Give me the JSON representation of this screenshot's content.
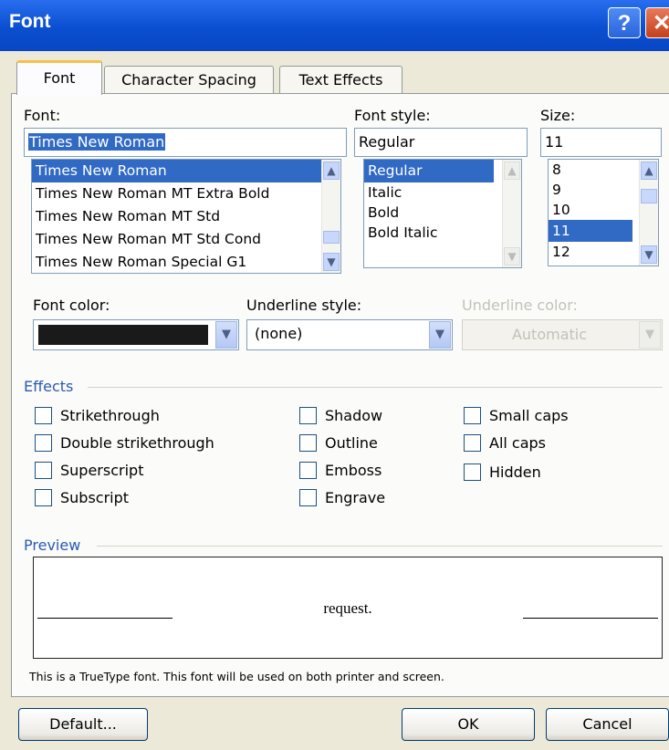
{
  "window": {
    "title": "Font",
    "help_glyph": "?",
    "close_glyph": "✕"
  },
  "tabs": [
    {
      "label": "Font",
      "active": true
    },
    {
      "label": "Character Spacing",
      "active": false
    },
    {
      "label": "Text Effects",
      "active": false
    }
  ],
  "font": {
    "label": "Font:",
    "value": "Times New Roman",
    "items": [
      "Times New Roman",
      "Times New Roman MT Extra Bold",
      "Times New Roman MT Std",
      "Times New Roman MT Std Cond",
      "Times New Roman Special G1"
    ],
    "selected_index": 0
  },
  "font_style": {
    "label": "Font style:",
    "value": "Regular",
    "items": [
      "Regular",
      "Italic",
      "Bold",
      "Bold Italic"
    ],
    "selected_index": 0
  },
  "size": {
    "label": "Size:",
    "value": "11",
    "items": [
      "8",
      "9",
      "10",
      "11",
      "12"
    ],
    "selected_index": 3
  },
  "font_color": {
    "label": "Font color:",
    "swatch": "#1a1a1a"
  },
  "underline_style": {
    "label": "Underline style:",
    "value": "(none)"
  },
  "underline_color": {
    "label": "Underline color:",
    "value": "Automatic",
    "disabled": true
  },
  "effects": {
    "label": "Effects",
    "col1": [
      "Strikethrough",
      "Double strikethrough",
      "Superscript",
      "Subscript"
    ],
    "col2": [
      "Shadow",
      "Outline",
      "Emboss",
      "Engrave"
    ],
    "col3": [
      "Small caps",
      "All caps",
      "Hidden"
    ]
  },
  "preview": {
    "label": "Preview",
    "text": "request.",
    "note": "This is a TrueType font. This font will be used on both printer and screen."
  },
  "buttons": {
    "default": "Default...",
    "ok": "OK",
    "cancel": "Cancel"
  },
  "colors": {
    "titlebar": "#0a4fd0",
    "selection": "#316ac5",
    "group_label": "#2a5ab6",
    "dialog_bg": "#ece9d8"
  }
}
